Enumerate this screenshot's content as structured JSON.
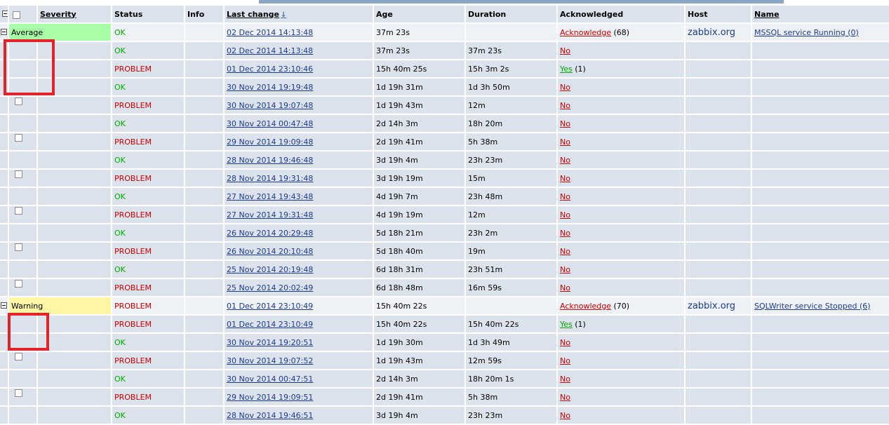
{
  "columns": {
    "severity": "Severity",
    "status": "Status",
    "info": "Info",
    "last_change": "Last change",
    "age": "Age",
    "duration": "Duration",
    "acknowledged": "Acknowledged",
    "host": "Host",
    "name": "Name"
  },
  "groups": [
    {
      "severity": "Average",
      "status": "OK",
      "last_change": "02 Dec 2014 14:13:48",
      "age": "37m 23s",
      "duration": "",
      "ack_link": "Acknowledge",
      "ack_count": "(68)",
      "host": "zabbix.org",
      "name": "MSSQL service Running (0)",
      "events": [
        {
          "status": "OK",
          "time": "02 Dec 2014 14:13:48",
          "age": "37m 23s",
          "duration": "37m 23s",
          "ack": "No",
          "ack_count": ""
        },
        {
          "status": "PROBLEM",
          "time": "01 Dec 2014 23:10:46",
          "age": "15h 40m 25s",
          "duration": "15h 3m 2s",
          "ack": "Yes",
          "ack_count": "(1)"
        },
        {
          "status": "OK",
          "time": "30 Nov 2014 19:19:48",
          "age": "1d 19h 31m",
          "duration": "1d 3h 50m",
          "ack": "No",
          "ack_count": ""
        },
        {
          "status": "PROBLEM",
          "time": "30 Nov 2014 19:07:48",
          "age": "1d 19h 43m",
          "duration": "12m",
          "ack": "No",
          "ack_count": ""
        },
        {
          "status": "OK",
          "time": "30 Nov 2014 00:47:48",
          "age": "2d 14h 3m",
          "duration": "18h 20m",
          "ack": "No",
          "ack_count": ""
        },
        {
          "status": "PROBLEM",
          "time": "29 Nov 2014 19:09:48",
          "age": "2d 19h 41m",
          "duration": "5h 38m",
          "ack": "No",
          "ack_count": ""
        },
        {
          "status": "OK",
          "time": "28 Nov 2014 19:46:48",
          "age": "3d 19h 4m",
          "duration": "23h 23m",
          "ack": "No",
          "ack_count": ""
        },
        {
          "status": "PROBLEM",
          "time": "28 Nov 2014 19:31:48",
          "age": "3d 19h 19m",
          "duration": "15m",
          "ack": "No",
          "ack_count": ""
        },
        {
          "status": "OK",
          "time": "27 Nov 2014 19:43:48",
          "age": "4d 19h 7m",
          "duration": "23h 48m",
          "ack": "No",
          "ack_count": ""
        },
        {
          "status": "PROBLEM",
          "time": "27 Nov 2014 19:31:48",
          "age": "4d 19h 19m",
          "duration": "12m",
          "ack": "No",
          "ack_count": ""
        },
        {
          "status": "OK",
          "time": "26 Nov 2014 20:29:48",
          "age": "5d 18h 21m",
          "duration": "23h 2m",
          "ack": "No",
          "ack_count": ""
        },
        {
          "status": "PROBLEM",
          "time": "26 Nov 2014 20:10:48",
          "age": "5d 18h 40m",
          "duration": "19m",
          "ack": "No",
          "ack_count": ""
        },
        {
          "status": "OK",
          "time": "25 Nov 2014 20:19:48",
          "age": "6d 18h 31m",
          "duration": "23h 51m",
          "ack": "No",
          "ack_count": ""
        },
        {
          "status": "PROBLEM",
          "time": "25 Nov 2014 20:02:49",
          "age": "6d 18h 48m",
          "duration": "16m 59s",
          "ack": "No",
          "ack_count": ""
        }
      ]
    },
    {
      "severity": "Warning",
      "status": "PROBLEM",
      "last_change": "01 Dec 2014 23:10:49",
      "age": "15h 40m 22s",
      "duration": "",
      "ack_link": "Acknowledge",
      "ack_count": "(70)",
      "host": "zabbix.org",
      "name": "SQLWriter service Stopped (6)",
      "events": [
        {
          "status": "PROBLEM",
          "time": "01 Dec 2014 23:10:49",
          "age": "15h 40m 22s",
          "duration": "15h 40m 22s",
          "ack": "Yes",
          "ack_count": "(1)"
        },
        {
          "status": "OK",
          "time": "30 Nov 2014 19:20:51",
          "age": "1d 19h 30m",
          "duration": "1d 3h 49m",
          "ack": "No",
          "ack_count": ""
        },
        {
          "status": "PROBLEM",
          "time": "30 Nov 2014 19:07:52",
          "age": "1d 19h 43m",
          "duration": "12m 59s",
          "ack": "No",
          "ack_count": ""
        },
        {
          "status": "OK",
          "time": "30 Nov 2014 00:47:51",
          "age": "2d 14h 3m",
          "duration": "18h 20m 1s",
          "ack": "No",
          "ack_count": ""
        },
        {
          "status": "PROBLEM",
          "time": "29 Nov 2014 19:09:51",
          "age": "2d 19h 41m",
          "duration": "5h 38m",
          "ack": "No",
          "ack_count": ""
        },
        {
          "status": "OK",
          "time": "28 Nov 2014 19:46:51",
          "age": "3d 19h 4m",
          "duration": "23h 23m",
          "ack": "No",
          "ack_count": ""
        }
      ]
    }
  ]
}
